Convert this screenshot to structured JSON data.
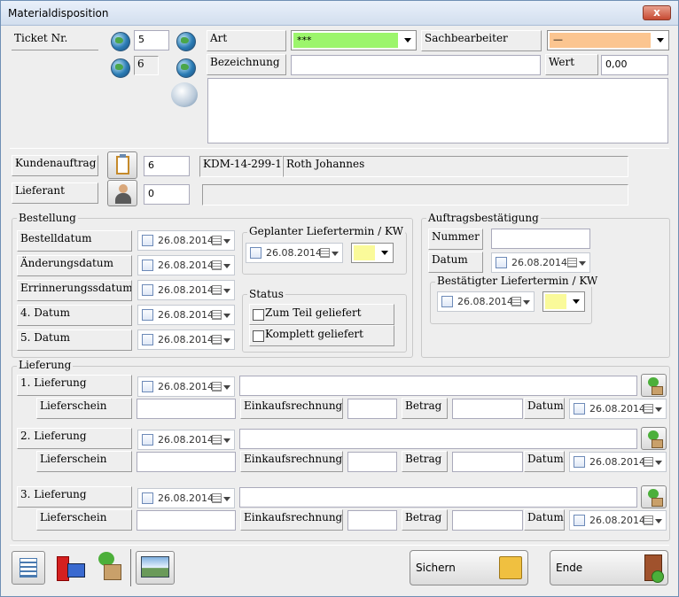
{
  "window": {
    "title": "Materialdisposition",
    "close": "x"
  },
  "ticket": {
    "label": "Ticket Nr.",
    "value1": "5",
    "value2": "6"
  },
  "art": {
    "label": "Art",
    "value": "***"
  },
  "sachbearbeiter": {
    "label": "Sachbearbeiter",
    "value": "—"
  },
  "bezeichnung": {
    "label": "Bezeichnung",
    "value": ""
  },
  "wert": {
    "label": "Wert",
    "value": "0,00"
  },
  "kundenauftrag": {
    "label": "Kundenauftrag",
    "value": "6",
    "code": "KDM-14-299-1",
    "name": "Roth Johannes"
  },
  "lieferant": {
    "label": "Lieferant",
    "value": "0",
    "name": ""
  },
  "bestellung": {
    "title": "Bestellung",
    "rows": [
      {
        "label": "Bestelldatum",
        "date": "26.08.2014"
      },
      {
        "label": "Änderungsdatum",
        "date": "26.08.2014"
      },
      {
        "label": "Errinnerungssdatum",
        "date": "26.08.2014"
      },
      {
        "label": "4. Datum",
        "date": "26.08.2014"
      },
      {
        "label": "5. Datum",
        "date": "26.08.2014"
      }
    ]
  },
  "geplant": {
    "title": "Geplanter Liefertermin / KW",
    "date": "26.08.2014"
  },
  "status": {
    "title": "Status",
    "opt1": "Zum Teil geliefert",
    "opt2": "Komplett geliefert"
  },
  "auftrag": {
    "title": "Auftragsbestätigung",
    "nummer_label": "Nummer",
    "nummer": "",
    "datum_label": "Datum",
    "datum": "26.08.2014",
    "bestaetigt_title": "Bestätigter Liefertermin / KW",
    "bestaetigt_date": "26.08.2014"
  },
  "lieferung": {
    "title": "Lieferung",
    "rows": [
      {
        "label": "1. Lieferung",
        "date": "26.08.2014",
        "schein": "Lieferschein",
        "rechnung": "Einkaufsrechnung",
        "betrag": "Betrag",
        "datum": "Datum",
        "datum_value": "26.08.2014"
      },
      {
        "label": "2. Lieferung",
        "date": "26.08.2014",
        "schein": "Lieferschein",
        "rechnung": "Einkaufsrechnung",
        "betrag": "Betrag",
        "datum": "Datum",
        "datum_value": "26.08.2014"
      },
      {
        "label": "3. Lieferung",
        "date": "26.08.2014",
        "schein": "Lieferschein",
        "rechnung": "Einkaufsrechnung",
        "betrag": "Betrag",
        "datum": "Datum",
        "datum_value": "26.08.2014"
      }
    ]
  },
  "footer": {
    "save": "Sichern",
    "end": "Ende"
  },
  "colors": {
    "art": "#9cf56c",
    "sachbearbeiter": "#fbc590",
    "kw": "#fafa9a"
  }
}
